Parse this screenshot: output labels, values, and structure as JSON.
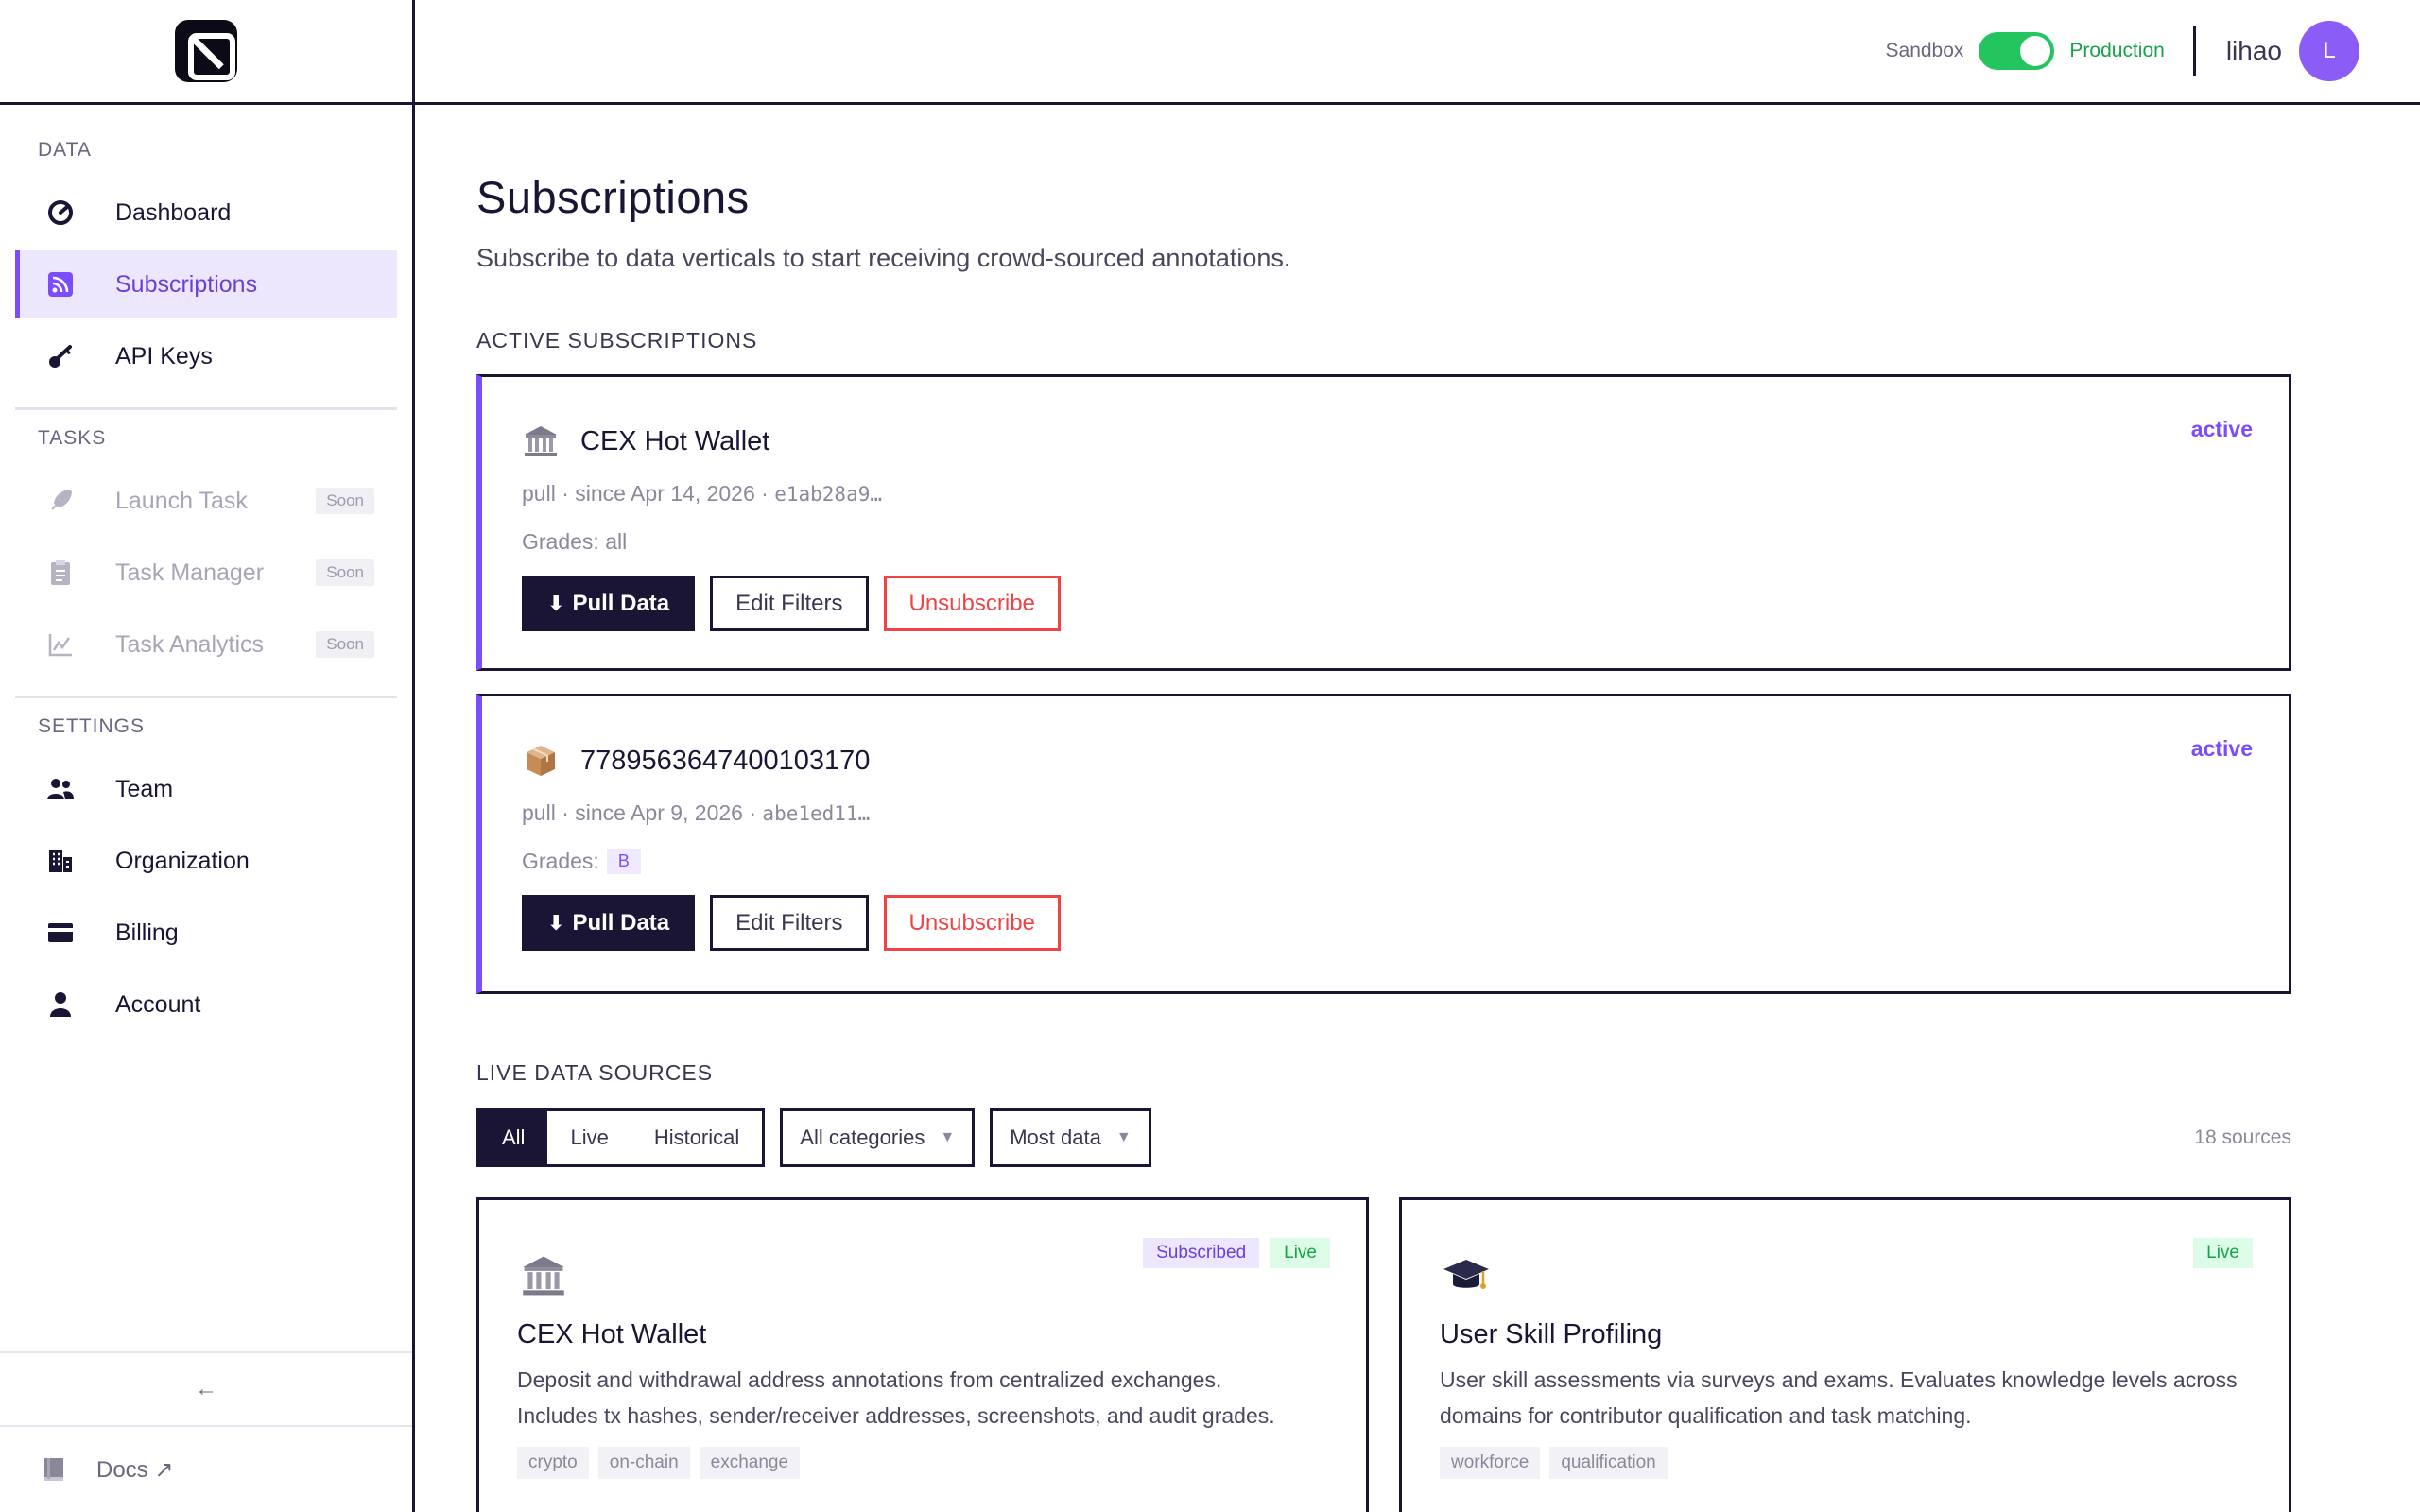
{
  "sidebar": {
    "sections": {
      "data": "DATA",
      "tasks": "TASKS",
      "settings": "SETTINGS"
    },
    "items": {
      "dashboard": "Dashboard",
      "subscriptions": "Subscriptions",
      "api_keys": "API Keys",
      "launch_task": "Launch Task",
      "task_manager": "Task Manager",
      "task_analytics": "Task Analytics",
      "team": "Team",
      "organization": "Organization",
      "billing": "Billing",
      "account": "Account"
    },
    "soon_label": "Soon",
    "collapse": "←",
    "docs": "Docs ↗"
  },
  "topbar": {
    "sandbox": "Sandbox",
    "production": "Production",
    "username": "lihao",
    "avatar_initial": "L"
  },
  "main": {
    "title": "Subscriptions",
    "subtitle": "Subscribe to data verticals to start receiving crowd-sourced annotations.",
    "active_heading": "ACTIVE SUBSCRIPTIONS",
    "live_heading": "LIVE DATA SOURCES"
  },
  "subscriptions": [
    {
      "name": "CEX Hot Wallet",
      "status": "active",
      "meta": "pull · since Apr 14, 2026 · ",
      "hash": "e1ab28a9…",
      "grades_label": "Grades: all",
      "grade_chip": ""
    },
    {
      "name": "7789563647400103170",
      "status": "active",
      "meta": "pull · since Apr 9, 2026 · ",
      "hash": "abe1ed11…",
      "grades_label": "Grades:",
      "grade_chip": "B"
    }
  ],
  "buttons": {
    "pull": "Pull Data",
    "edit": "Edit Filters",
    "unsubscribe": "Unsubscribe"
  },
  "filters": {
    "all": "All",
    "live": "Live",
    "historical": "Historical",
    "category": "All categories",
    "sort": "Most data",
    "count": "18 sources"
  },
  "sources": [
    {
      "name": "CEX Hot Wallet",
      "badge_subscribed": "Subscribed",
      "badge_live": "Live",
      "desc_line1": "Deposit and withdrawal address annotations from centralized exchanges.",
      "desc_line2": "Includes tx hashes, sender/receiver addresses, screenshots, and audit grades.",
      "tags": [
        "crypto",
        "on-chain",
        "exchange"
      ]
    },
    {
      "name": "User Skill Profiling",
      "badge_live": "Live",
      "desc_line1": "User skill assessments via surveys and exams. Evaluates knowledge levels across",
      "desc_line2": "domains for contributor qualification and task matching.",
      "tags": [
        "workforce",
        "qualification"
      ]
    }
  ],
  "colors": {
    "accent": "#7c4dff",
    "ink": "#1b1535",
    "live_green": "#22c55e",
    "danger": "#ef4444"
  }
}
